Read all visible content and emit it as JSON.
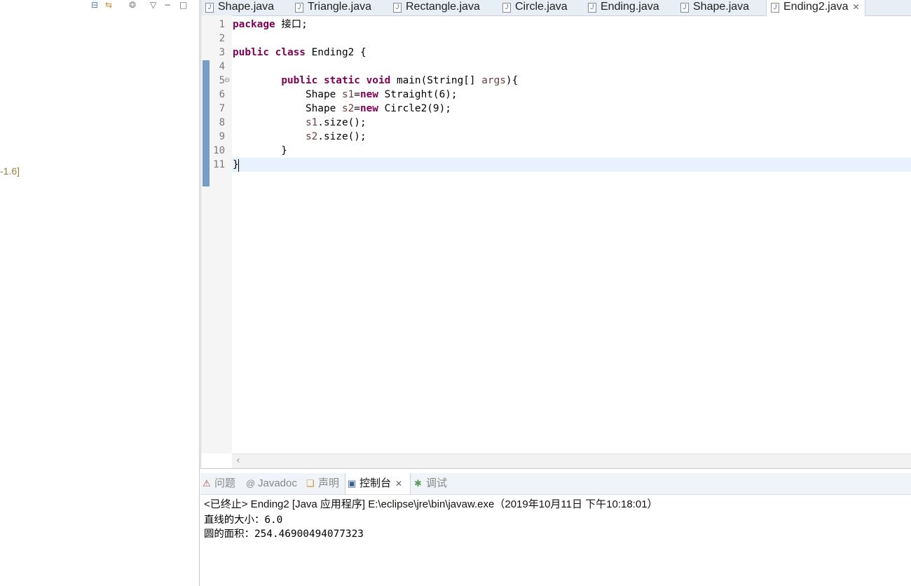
{
  "left_panel": {
    "fragment_text": "-1.6]"
  },
  "editor": {
    "tabs": [
      {
        "label": "Shape.java"
      },
      {
        "label": "Triangle.java"
      },
      {
        "label": "Rectangle.java"
      },
      {
        "label": "Circle.java"
      },
      {
        "label": "Ending.java"
      },
      {
        "label": "Shape.java"
      },
      {
        "label": "Ending2.java",
        "active": true
      }
    ],
    "close_glyph": "✕",
    "line_numbers": [
      "1",
      "2",
      "3",
      "4",
      "5",
      "6",
      "7",
      "8",
      "9",
      "10",
      "11"
    ],
    "code": {
      "l1_kw": "package",
      "l1_rest": " 接口;",
      "l3_kw1": "public",
      "l3_kw2": "class",
      "l3_rest": " Ending2 {",
      "l5_indent": "        ",
      "l5_kw1": "public",
      "l5_kw2": "static",
      "l5_kw3": "void",
      "l5_mid": " main(String[] ",
      "l5_var": "args",
      "l5_end": "){",
      "l6_a": "            Shape ",
      "l6_var": "s1",
      "l6_eq": "=",
      "l6_kw": "new",
      "l6_rest": " Straight(6);",
      "l7_a": "            Shape ",
      "l7_var": "s2",
      "l7_eq": "=",
      "l7_kw": "new",
      "l7_rest": " Circle2(9);",
      "l8_a": "            ",
      "l8_var": "s1",
      "l8_rest": ".size();",
      "l9_a": "            ",
      "l9_var": "s2",
      "l9_rest": ".size();",
      "l10": "        }",
      "l11": "}"
    }
  },
  "console": {
    "tabs": [
      {
        "label": "问题",
        "icon": "problems-icon"
      },
      {
        "label": "Javadoc",
        "icon": "at-icon"
      },
      {
        "label": "声明",
        "icon": "declaration-icon"
      },
      {
        "label": "控制台",
        "icon": "console-icon",
        "active": true
      },
      {
        "label": "调试",
        "icon": "debug-icon"
      }
    ],
    "status": "<已终止> Ending2 [Java 应用程序] E:\\eclipse\\jre\\bin\\javaw.exe（2019年10月11日 下午10:18:01）",
    "output": [
      "直线的大小：6.0",
      "圆的面积：254.46900494077323"
    ]
  }
}
